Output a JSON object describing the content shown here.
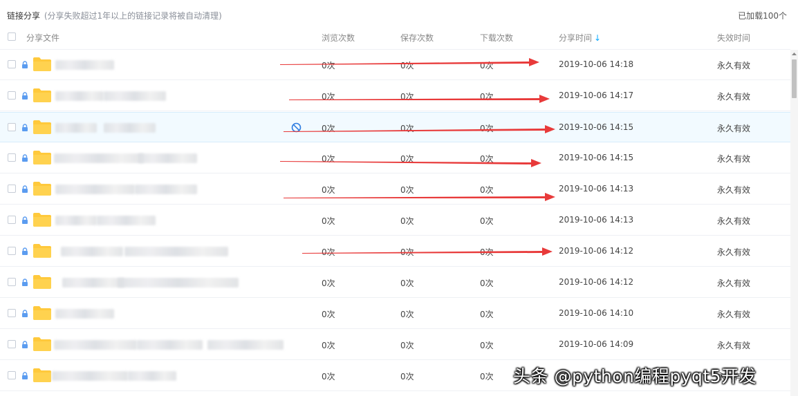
{
  "header": {
    "title": "链接分享",
    "subtitle": "(分享失败超过1年以上的链接记录将被自动清理)",
    "loaded": "已加载100个"
  },
  "columns": {
    "file": "分享文件",
    "views": "浏览次数",
    "saves": "保存次数",
    "downloads": "下载次数",
    "share_time": "分享时间",
    "expire": "失效时间"
  },
  "rows": [
    {
      "views": "0次",
      "saves": "0次",
      "downloads": "0次",
      "time": "2019-10-06 14:18",
      "expire": "永久有效"
    },
    {
      "views": "0次",
      "saves": "0次",
      "downloads": "0次",
      "time": "2019-10-06 14:17",
      "expire": "永久有效"
    },
    {
      "views": "0次",
      "saves": "0次",
      "downloads": "0次",
      "time": "2019-10-06 14:15",
      "expire": "永久有效"
    },
    {
      "views": "0次",
      "saves": "0次",
      "downloads": "0次",
      "time": "2019-10-06 14:15",
      "expire": "永久有效"
    },
    {
      "views": "0次",
      "saves": "0次",
      "downloads": "0次",
      "time": "2019-10-06 14:13",
      "expire": "永久有效"
    },
    {
      "views": "0次",
      "saves": "0次",
      "downloads": "0次",
      "time": "2019-10-06 14:13",
      "expire": "永久有效"
    },
    {
      "views": "0次",
      "saves": "0次",
      "downloads": "0次",
      "time": "2019-10-06 14:12",
      "expire": "永久有效"
    },
    {
      "views": "0次",
      "saves": "0次",
      "downloads": "0次",
      "time": "2019-10-06 14:12",
      "expire": "永久有效"
    },
    {
      "views": "0次",
      "saves": "0次",
      "downloads": "0次",
      "time": "2019-10-06 14:10",
      "expire": "永久有效"
    },
    {
      "views": "0次",
      "saves": "0次",
      "downloads": "0次",
      "time": "2019-10-06 14:09",
      "expire": "永久有效"
    },
    {
      "views": "0次",
      "saves": "0次",
      "downloads": "0次",
      "time": "",
      "expire": "永久有效"
    }
  ],
  "watermark": "头条 @python编程pyqt5开发",
  "colors": {
    "accent": "#09aaff",
    "folder": "#ffc93c",
    "lock": "#5b9cf0",
    "arrow": "#e83a3a",
    "hover_row": "#f2faff"
  }
}
